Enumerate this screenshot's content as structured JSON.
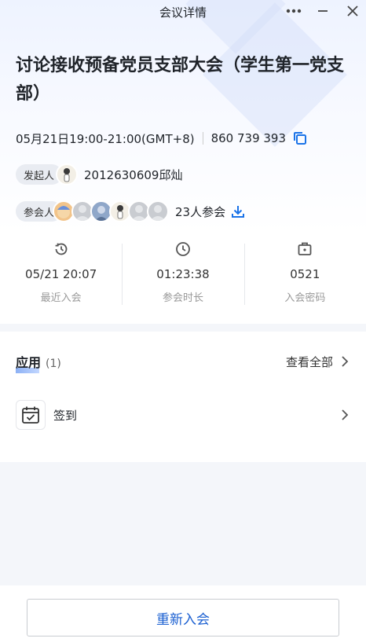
{
  "window": {
    "title": "会议详情"
  },
  "meeting": {
    "title": "讨论接收预备党员支部大会（学生第一党支部）",
    "time": "05月21日19:00-21:00(GMT+8)",
    "meeting_id": "860 739 393"
  },
  "initiator": {
    "label": "发起人",
    "name": "2012630609邱灿"
  },
  "attendees": {
    "label": "参会人",
    "count_text": "23人参会"
  },
  "stats": [
    {
      "icon": "history-icon",
      "value": "05/21 20:07",
      "label": "最近入会"
    },
    {
      "icon": "clock-icon",
      "value": "01:23:38",
      "label": "参会时长"
    },
    {
      "icon": "lock-box-icon",
      "value": "0521",
      "label": "入会密码"
    }
  ],
  "apps": {
    "title": "应用",
    "count": "(1)",
    "view_all": "查看全部",
    "items": [
      {
        "icon": "calendar-check-icon",
        "label": "签到"
      }
    ]
  },
  "footer": {
    "rejoin_label": "重新入会"
  },
  "colors": {
    "accent": "#1a73e8",
    "link_button_text": "#1a5fd1"
  }
}
